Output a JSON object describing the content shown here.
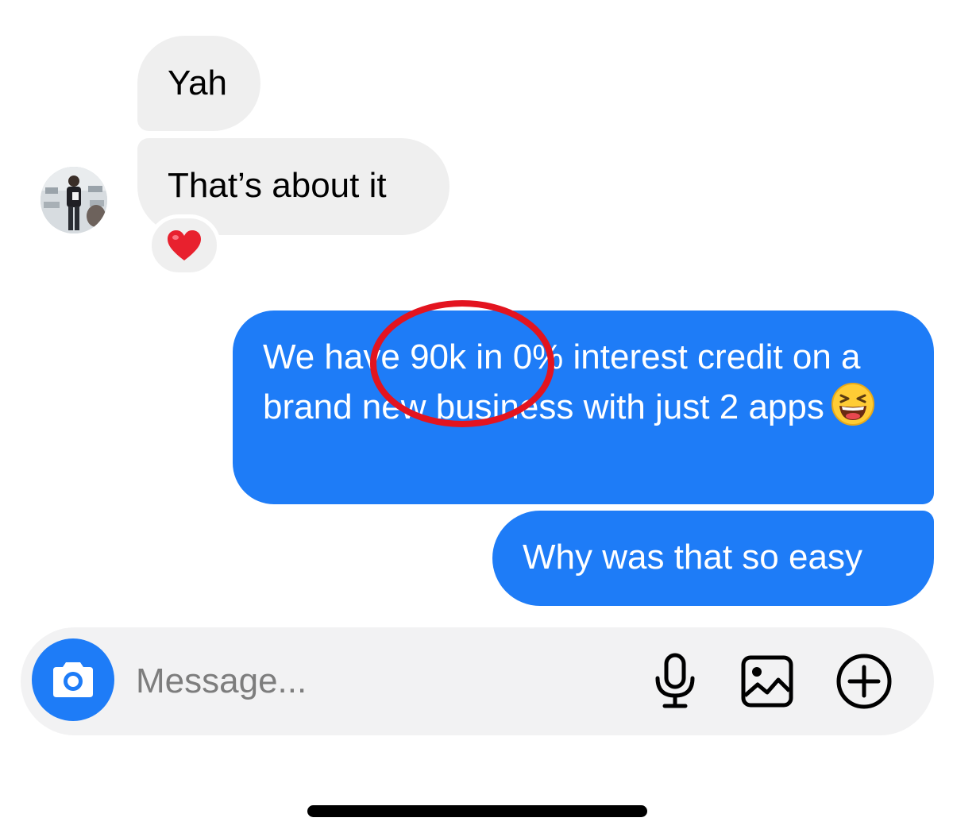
{
  "thread": {
    "messages": [
      {
        "direction": "incoming",
        "text": "Yah"
      },
      {
        "direction": "incoming",
        "text": "That’s about it",
        "reaction": "heart"
      },
      {
        "direction": "outgoing",
        "text": "We have 90k in 0% interest credit on a brand new business with just 2 apps",
        "emoji": "laughing-face"
      },
      {
        "direction": "outgoing",
        "text": "Why was that so easy"
      }
    ]
  },
  "composer": {
    "placeholder": "Message...",
    "icons": [
      "camera-icon",
      "microphone-icon",
      "gallery-icon",
      "plus-icon"
    ]
  },
  "colors": {
    "outgoing_bubble": "#1e7cf7",
    "incoming_bubble": "#efefef",
    "annotation_circle": "#e3141f",
    "composer_background": "#f2f2f3"
  }
}
